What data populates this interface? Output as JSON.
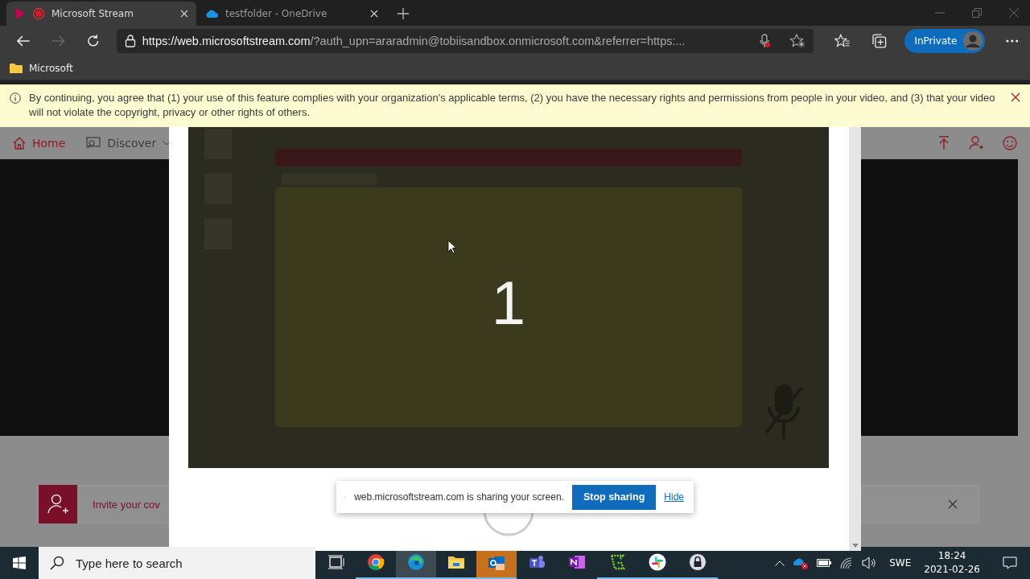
{
  "browser": {
    "tabs": [
      {
        "title": "Microsoft Stream",
        "selected": true,
        "recording": true
      },
      {
        "title": "testfolder - OneDrive",
        "selected": false,
        "recording": false
      }
    ],
    "url": {
      "host": "https://web.microsoftstream.com",
      "rest": "/?auth_upn=araradmin@tobiisandbox.onmicrosoft.com&referrer=https:..."
    },
    "inprivate": "InPrivate",
    "favorites": [
      {
        "label": "Microsoft"
      }
    ]
  },
  "notice": {
    "text": "By continuing, you agree that (1) your use of this feature complies with your organization's applicable terms, (2) you have the necessary rights and permissions from people in your video, and (3) that your video will not violate the copyright, privacy or other rights of others."
  },
  "page": {
    "nav": [
      {
        "label": "Home",
        "selected": true
      },
      {
        "label": "Discover",
        "selected": false
      }
    ],
    "invite": "Invite your cov"
  },
  "countdown": {
    "value": "1"
  },
  "share_bar": {
    "message": "web.microsoftstream.com is sharing your screen.",
    "stop": "Stop sharing",
    "hide": "Hide"
  },
  "taskbar": {
    "search_placeholder": "Type here to search",
    "apps": [
      {
        "kind": "taskview",
        "running": false,
        "active": false
      },
      {
        "kind": "chrome",
        "running": true,
        "active": false
      },
      {
        "kind": "edge",
        "running": true,
        "active": true
      },
      {
        "kind": "explorer",
        "running": true,
        "active": false
      },
      {
        "kind": "outlook",
        "running": true,
        "active": false,
        "flashing": true
      },
      {
        "kind": "teams",
        "running": false,
        "active": false
      },
      {
        "kind": "onenote",
        "running": false,
        "active": false
      },
      {
        "kind": "snipper",
        "running": true,
        "active": false
      },
      {
        "kind": "slack",
        "running": true,
        "active": false
      },
      {
        "kind": "keepass",
        "running": true,
        "active": false
      }
    ],
    "language": "SWE",
    "time": "18:24",
    "date": "2021-02-26"
  }
}
